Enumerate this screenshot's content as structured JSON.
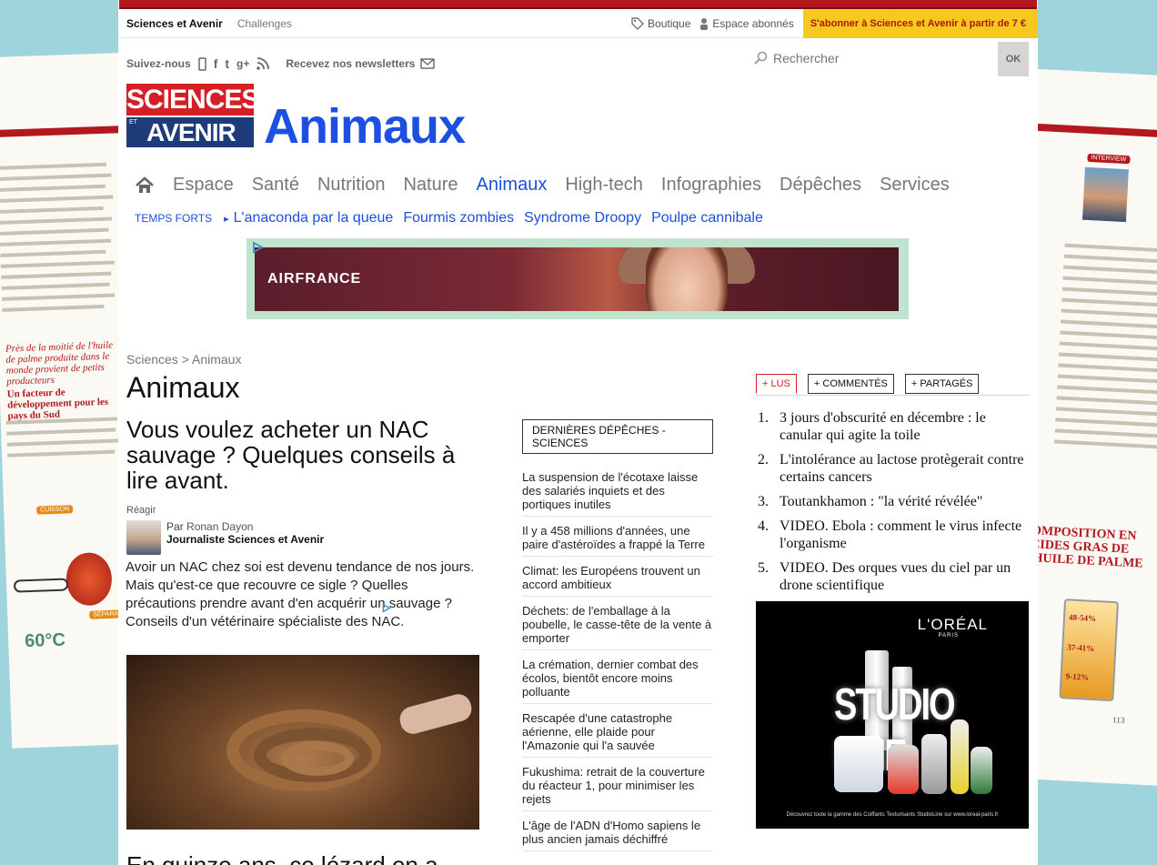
{
  "header": {
    "brand": "Sciences et Avenir",
    "challenges": "Challenges",
    "boutique": "Boutique",
    "espace_abonnes": "Espace abonnés",
    "subscribe": "S'abonner à Sciences et Avenir à partir de 7 €"
  },
  "follow": {
    "label": "Suivez-nous",
    "newsletters": "Recevez nos newsletters"
  },
  "search": {
    "placeholder": "Rechercher",
    "ok": "OK"
  },
  "logo": {
    "line1": "SCIENCES",
    "et": "ET",
    "line2": "AVENIR"
  },
  "section_title": "Animaux",
  "nav": {
    "items": [
      "Espace",
      "Santé",
      "Nutrition",
      "Nature",
      "Animaux",
      "High-tech",
      "Infographies",
      "Dépêches",
      "Services"
    ],
    "active": "Animaux"
  },
  "temps_forts": {
    "label": "TEMPS FORTS",
    "links": [
      "L'anaconda par la queue",
      "Fourmis zombies",
      "Syndrome Droopy",
      "Poulpe cannibale"
    ]
  },
  "ad_banner": {
    "text": "AIRFRANCE"
  },
  "breadcrumb": "Sciences > Animaux",
  "heading": "Animaux",
  "article": {
    "title": "Vous voulez acheter un NAC sauvage ? Quelques conseils à lire avant.",
    "reagir": "Réagir",
    "by": "Par",
    "author": "Ronan Dayon",
    "role": "Journaliste Sciences et Avenir",
    "lead": "Avoir un NAC chez soi est devenu tendance de nos jours. Mais qu'est-ce que recouvre ce sigle ? Quelles précautions prendre avant d'en acquérir un sauvage ? Conseils d'un vétérinaire spécialiste des NAC.",
    "next_title": "En quinze ans, ce lézard en a"
  },
  "depeches": {
    "header": "DERNIÈRES DÉPÊCHES - SCIENCES",
    "items": [
      "La suspension de l'écotaxe laisse des salariés inquiets et des portiques inutiles",
      "Il y a 458 millions d'années, une paire d'astéroïdes a frappé la Terre",
      "Climat: les Européens trouvent un accord ambitieux",
      "Déchets: de l'emballage à la poubelle, le casse-tête de la vente à emporter",
      "La crémation, dernier combat des écolos, bientôt encore moins polluante",
      "Rescapée d'une catastrophe aérienne, elle plaide pour l'Amazonie qui l'a sauvée",
      "Fukushima: retrait de la couverture du réacteur 1, pour minimiser les rejets",
      "L'âge de l'ADN d'Homo sapiens le plus ancien jamais déchiffré"
    ]
  },
  "popular": {
    "tabs": [
      "+ LUS",
      "+ COMMENTÉS",
      "+ PARTAGÉS"
    ],
    "active_tab": "+ LUS",
    "items": [
      {
        "n": "1.",
        "text": "3 jours d'obscurité en décembre : le canular qui agite la toile"
      },
      {
        "n": "2.",
        "text": "L'intolérance au lactose protègerait contre certains cancers"
      },
      {
        "n": "3.",
        "text": "Toutankhamon : \"la vérité révélée\""
      },
      {
        "n": "4.",
        "text": "VIDEO. Ebola : comment le virus infecte l'organisme"
      },
      {
        "n": "5.",
        "text": "VIDEO. Des orques vues du ciel par un drone scientifique"
      }
    ]
  },
  "ad_square": {
    "brand": "L'ORÉAL",
    "city": "PARIS",
    "product": "STUDIO LINE",
    "footer": "Découvrez toute la gamme des Coiffants Texturisants StudioLine sur www.loreal-paris.fr"
  },
  "background_pages": {
    "left": {
      "quote": "Près de la moitié de l'huile de palme produite dans le monde provient de petits producteurs",
      "subhead": "Un facteur de développement pour les pays du Sud",
      "cuisson": "CUISSON",
      "separation": "SÉPARATION",
      "temp": "60°C"
    },
    "right": {
      "interview": "INTERVIEW",
      "composition": "COMPOSITION EN ACIDES GRAS DE L'HUILE DE PALME",
      "pcts": [
        "48-54%",
        "37-41%",
        "9-12%"
      ],
      "page": "113"
    }
  }
}
